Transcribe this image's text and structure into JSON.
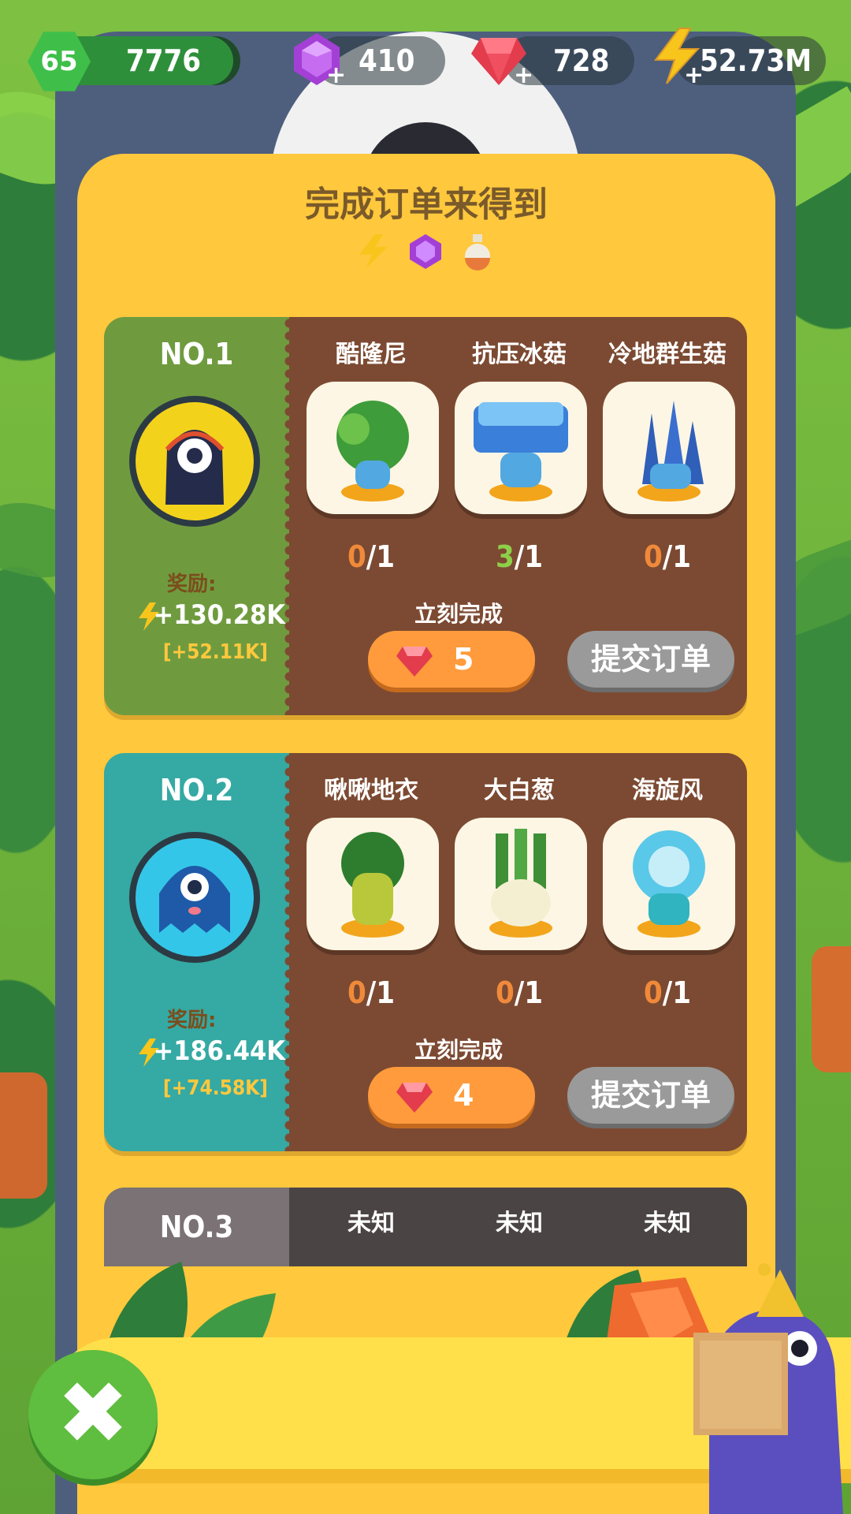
{
  "status_bar": {
    "level": "65",
    "xp": "7776",
    "purple_gems": "410",
    "red_gems": "728",
    "energy": "52.73M"
  },
  "panel": {
    "title": "完成订单来得到",
    "reward_icons": [
      "lightning-icon",
      "purple-gem-icon",
      "potion-icon"
    ]
  },
  "orders": [
    {
      "number": "NO.1",
      "color": "#6f9b3e",
      "avatar_color": "#f3d21c",
      "reward_label": "奖励:",
      "reward": "+130.28K",
      "bonus": "[+52.11K]",
      "items": [
        {
          "name": "酷隆尼",
          "have": "0",
          "need": "/1"
        },
        {
          "name": "抗压冰菇",
          "have": "3",
          "need": "/1"
        },
        {
          "name": "冷地群生菇",
          "have": "0",
          "need": "/1"
        }
      ],
      "instant_label": "立刻完成",
      "instant_cost": "5",
      "submit_label": "提交订单"
    },
    {
      "number": "NO.2",
      "color": "#35a9a3",
      "avatar_color": "#34c6e8",
      "reward_label": "奖励:",
      "reward": "+186.44K",
      "bonus": "[+74.58K]",
      "items": [
        {
          "name": "啾啾地衣",
          "have": "0",
          "need": "/1"
        },
        {
          "name": "大白葱",
          "have": "0",
          "need": "/1"
        },
        {
          "name": "海旋风",
          "have": "0",
          "need": "/1"
        }
      ],
      "instant_label": "立刻完成",
      "instant_cost": "4",
      "submit_label": "提交订单"
    },
    {
      "number": "NO.3",
      "items": [
        {
          "name": "未知"
        },
        {
          "name": "未知"
        },
        {
          "name": "未知"
        }
      ]
    }
  ],
  "close_button": "✖"
}
